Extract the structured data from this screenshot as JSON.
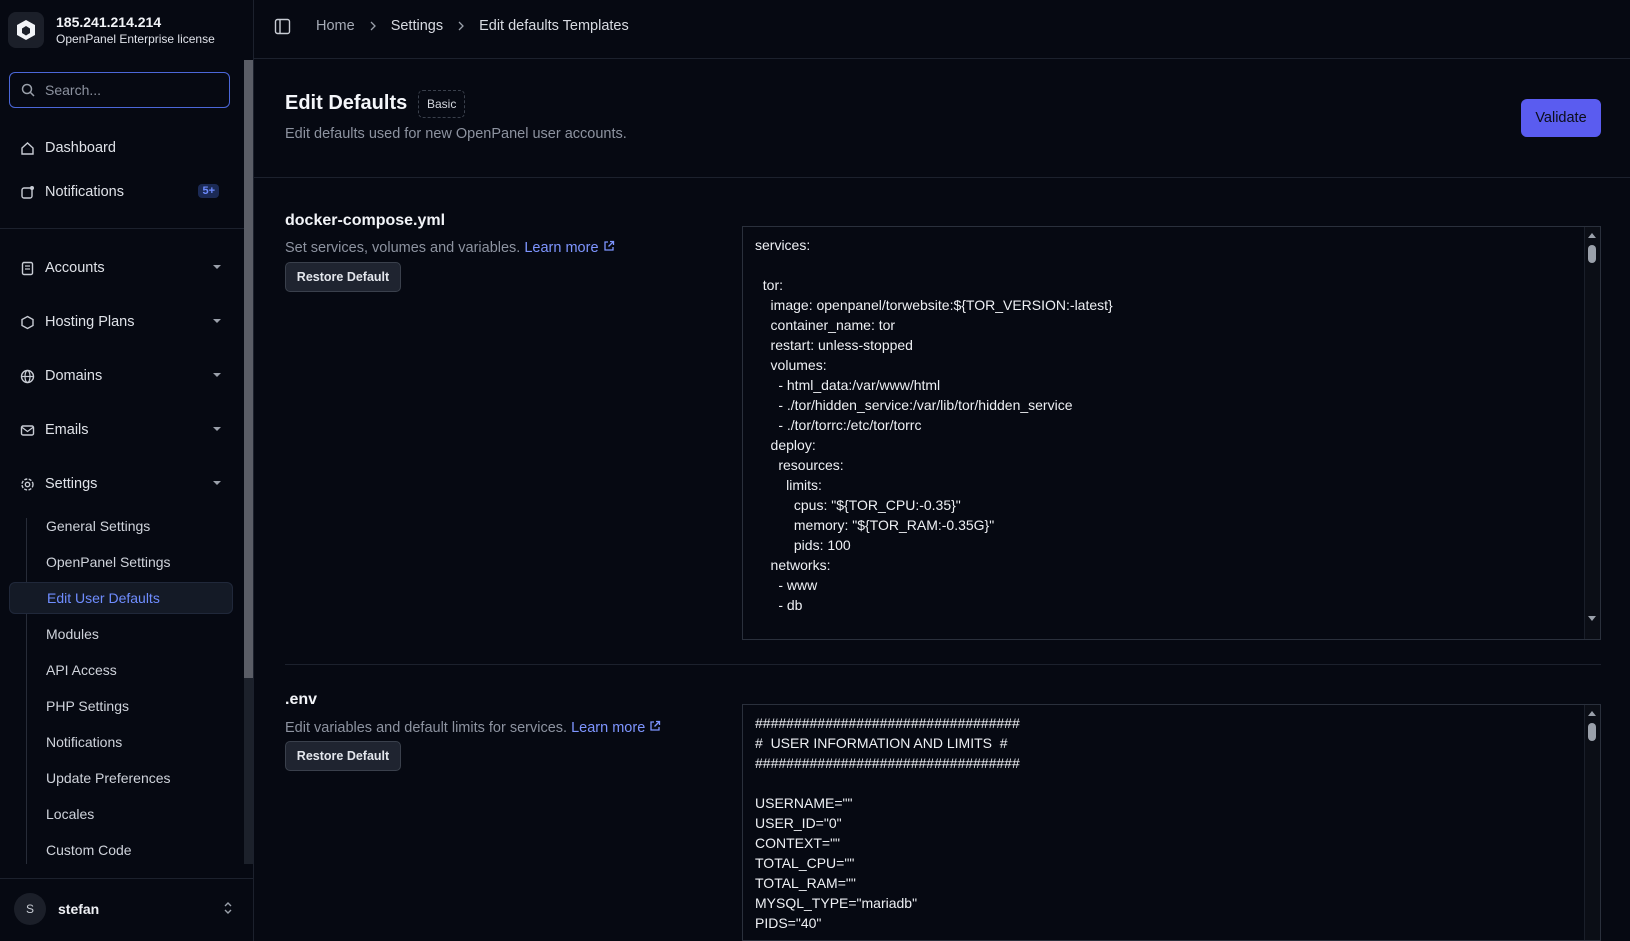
{
  "brand": {
    "ip": "185.241.214.214",
    "license": "OpenPanel Enterprise license"
  },
  "search": {
    "placeholder": "Search..."
  },
  "nav": {
    "dashboard": "Dashboard",
    "notifications": "Notifications",
    "notifications_badge": "5+",
    "accounts": "Accounts",
    "hosting_plans": "Hosting Plans",
    "domains": "Domains",
    "emails": "Emails",
    "settings": "Settings"
  },
  "settings_sub": [
    "General Settings",
    "OpenPanel Settings",
    "Edit User Defaults",
    "Modules",
    "API Access",
    "PHP Settings",
    "Notifications",
    "Update Preferences",
    "Locales",
    "Custom Code"
  ],
  "user": {
    "initial": "S",
    "name": "stefan"
  },
  "breadcrumb": [
    "Home",
    "Settings",
    "Edit defaults Templates"
  ],
  "page": {
    "title": "Edit Defaults",
    "badge": "Basic",
    "description": "Edit defaults used for new OpenPanel user accounts.",
    "validate_label": "Validate"
  },
  "sections": [
    {
      "title": "docker-compose.yml",
      "description": "Set services, volumes and variables.",
      "learn_more": "Learn more",
      "restore_label": "Restore Default",
      "content": "services:\n\n  tor:\n    image: openpanel/torwebsite:${TOR_VERSION:-latest}\n    container_name: tor\n    restart: unless-stopped\n    volumes:\n      - html_data:/var/www/html\n      - ./tor/hidden_service:/var/lib/tor/hidden_service\n      - ./tor/torrc:/etc/tor/torrc\n    deploy:\n      resources:\n        limits:\n          cpus: \"${TOR_CPU:-0.35}\"\n          memory: \"${TOR_RAM:-0.35G}\"\n          pids: 100\n    networks:\n      - www\n      - db\n\n    litespeed:"
    },
    {
      "title": ".env",
      "description": "Edit variables and default limits for services.",
      "learn_more": "Learn more",
      "restore_label": "Restore Default",
      "content": "##################################\n#  USER INFORMATION AND LIMITS  #\n##################################\n\nUSERNAME=\"\"\nUSER_ID=\"0\"\nCONTEXT=\"\"\nTOTAL_CPU=\"\"\nTOTAL_RAM=\"\"\nMYSQL_TYPE=\"mariadb\"\nPIDS=\"40\""
    }
  ],
  "colors": {
    "accent": "#5a5cf0",
    "link": "#7e95ff",
    "background": "#060912"
  }
}
